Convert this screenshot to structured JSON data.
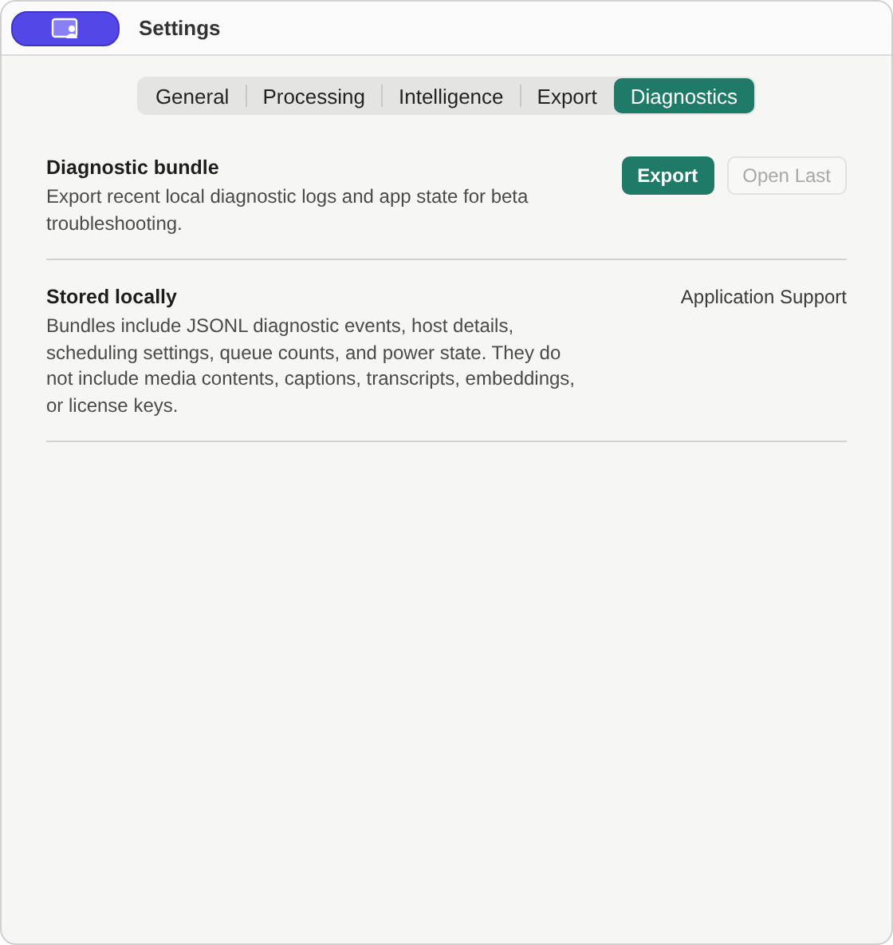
{
  "window": {
    "title": "Settings"
  },
  "tabs": [
    {
      "label": "General",
      "selected": false
    },
    {
      "label": "Processing",
      "selected": false
    },
    {
      "label": "Intelligence",
      "selected": false
    },
    {
      "label": "Export",
      "selected": false
    },
    {
      "label": "Diagnostics",
      "selected": true
    }
  ],
  "sections": [
    {
      "title": "Diagnostic bundle",
      "description": "Export recent local diagnostic logs and app state for beta troubleshooting.",
      "kind": "actions",
      "buttons": [
        {
          "label": "Export",
          "primary": true,
          "disabled": false
        },
        {
          "label": "Open Last",
          "primary": false,
          "disabled": true
        }
      ]
    },
    {
      "title": "Stored locally",
      "description": "Bundles include JSONL diagnostic events, host details, scheduling settings, queue counts, and power state. They do not include media contents, captions, transcripts, embeddings, or license keys.",
      "kind": "value",
      "value": "Application Support"
    }
  ]
}
